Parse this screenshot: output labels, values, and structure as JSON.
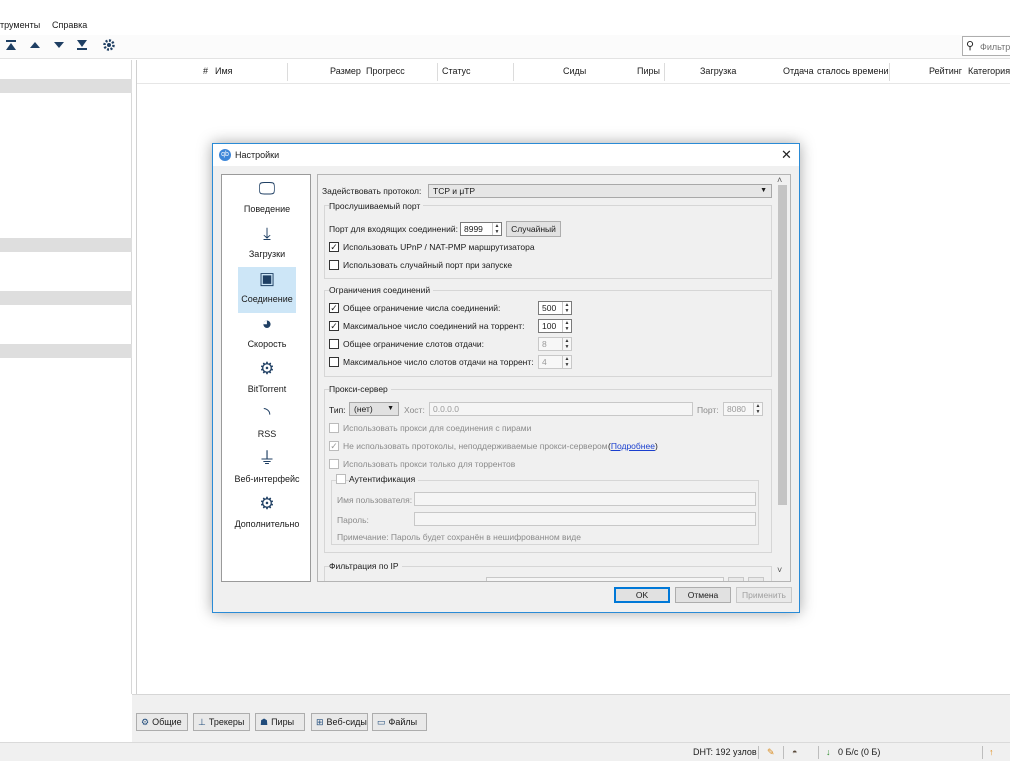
{
  "menu": {
    "tools": "трументы",
    "help": "Справка"
  },
  "toolbar": {
    "icons": [
      "move-top-icon",
      "move-up-icon",
      "move-down-icon",
      "move-bottom-icon",
      "gear-icon"
    ],
    "filter_placeholder": "Фильтр"
  },
  "columns": [
    "#",
    "Имя",
    "Размер",
    "Прогресс",
    "Статус",
    "Сиды",
    "Пиры",
    "Загрузка",
    "Отдача",
    "сталось времени",
    "Рейтинг",
    "Категория"
  ],
  "bottom_tabs": [
    "Общие",
    "Трекеры",
    "Пиры",
    "Веб-сиды",
    "Файлы"
  ],
  "status": {
    "dht": "DHT: 192 узлов",
    "download": "0 Б/с (0 Б)"
  },
  "dialog": {
    "title": "Настройки",
    "categories": [
      "Поведение",
      "Загрузки",
      "Соединение",
      "Скорость",
      "BitTorrent",
      "RSS",
      "Веб-интерфейс",
      "Дополнительно"
    ],
    "selected_category": "Соединение",
    "protocol_label": "Задействовать протокол:",
    "protocol_value": "TCP и μTP",
    "listen_port": {
      "title": "Прослушиваемый порт",
      "port_label": "Порт для входящих соединений:",
      "port_value": "8999",
      "random_button": "Случайный",
      "upnp_label": "Использовать UPnP / NAT-PMP маршрутизатора",
      "upnp_checked": true,
      "random_port_label": "Использовать случайный порт при запуске",
      "random_port_checked": false
    },
    "limits": {
      "title": "Ограничения соединений",
      "rows": [
        {
          "label": "Общее ограничение числа соединений:",
          "value": "500",
          "checked": true
        },
        {
          "label": "Максимальное число соединений на торрент:",
          "value": "100",
          "checked": true
        },
        {
          "label": "Общее ограничение слотов отдачи:",
          "value": "8",
          "checked": false
        },
        {
          "label": "Максимальное число слотов отдачи на торрент:",
          "value": "4",
          "checked": false
        }
      ]
    },
    "proxy": {
      "title": "Прокси-сервер",
      "type_label": "Тип:",
      "type_value": "(нет)",
      "host_label": "Хост:",
      "host_value": "0.0.0.0",
      "port_label": "Порт:",
      "port_value": "8080",
      "use_for_peers": "Использовать прокси для соединения с пирами",
      "no_unsupported": "Не использовать протоколы, неподдерживаемые прокси-сервером",
      "more_link": "Подробнее",
      "only_torrents": "Использовать прокси только для торрентов",
      "auth_title": "Аутентификация",
      "username_label": "Имя пользователя:",
      "password_label": "Пароль:",
      "note": "Примечание: Пароль будет сохранён в нешифрованном виде"
    },
    "ip_filter_title": "Фильтрация по IP",
    "buttons": {
      "ok": "OK",
      "cancel": "Отмена",
      "apply": "Применить"
    }
  }
}
